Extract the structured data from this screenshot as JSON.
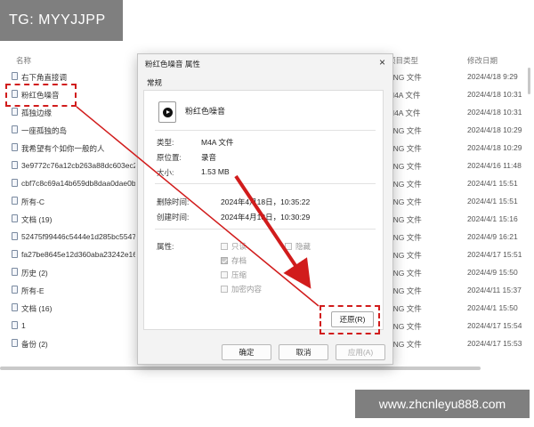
{
  "watermarks": {
    "top": "TG: MYYJJPP",
    "bottom": "www.zhcnleyu888.com"
  },
  "explorer": {
    "columns": {
      "name": "名称",
      "type": "项目类型",
      "date": "修改日期"
    },
    "rows": [
      {
        "name": "右下角直接调",
        "type": "PNG 文件",
        "date": "2024/4/18 9:29"
      },
      {
        "name": "粉红色噪音",
        "type": "M4A 文件",
        "date": "2024/4/18 10:31"
      },
      {
        "name": "孤独边缘",
        "type": "M4A 文件",
        "date": "2024/4/18 10:31"
      },
      {
        "name": "一座孤独的岛",
        "type": "PNG 文件",
        "date": "2024/4/18 10:29"
      },
      {
        "name": "我希望有个如你一般的人",
        "type": "PNG 文件",
        "date": "2024/4/18 10:29"
      },
      {
        "name": "3e9772c76a12cb263a88dc603ec2",
        "type": "PNG 文件",
        "date": "2024/4/16 11:48"
      },
      {
        "name": "cbf7c8c69a14b659db8daa0dae0b",
        "type": "PNG 文件",
        "date": "2024/4/1 15:51"
      },
      {
        "name": "所有-C",
        "type": "PNG 文件",
        "date": "2024/4/1 15:51"
      },
      {
        "name": "文档 (19)",
        "type": "PNG 文件",
        "date": "2024/4/1 15:16"
      },
      {
        "name": "52475f99446c5444e1d285bc5547",
        "type": "PNG 文件",
        "date": "2024/4/9 16:21"
      },
      {
        "name": "fa27be8645e12d360aba23242e16",
        "type": "PNG 文件",
        "date": "2024/4/17 15:51"
      },
      {
        "name": "历史 (2)",
        "type": "PNG 文件",
        "date": "2024/4/9 15:50"
      },
      {
        "name": "所有-E",
        "type": "PNG 文件",
        "date": "2024/4/11 15:37"
      },
      {
        "name": "文档 (16)",
        "type": "PNG 文件",
        "date": "2024/4/1 15:50"
      },
      {
        "name": "1",
        "type": "PNG 文件",
        "date": "2024/4/17 15:54"
      },
      {
        "name": "备份 (2)",
        "type": "PNG 文件",
        "date": "2024/4/17 15:53"
      }
    ]
  },
  "dialog": {
    "title": "粉红色噪音 属性",
    "close": "×",
    "tab": "常规",
    "file_name": "粉红色噪音",
    "props": {
      "type_label": "类型:",
      "type_value": "M4A 文件",
      "location_label": "原位置:",
      "location_value": "录音",
      "size_label": "大小:",
      "size_value": "1.53 MB",
      "deleted_label": "删除时间:",
      "deleted_value": "2024年4月18日，10:35:22",
      "created_label": "创建时间:",
      "created_value": "2024年4月18日，10:30:29",
      "attributes_label": "属性:"
    },
    "attributes": {
      "readonly": "只读",
      "hidden": "隐藏",
      "archive": "存档",
      "compress": "压缩",
      "encrypt": "加密内容"
    },
    "restore": "还原(R)",
    "buttons": {
      "ok": "确定",
      "cancel": "取消",
      "apply": "应用(A)"
    }
  },
  "colors": {
    "highlight": "#d11c1c",
    "tab_underline": "#2e6fd4",
    "watermark_bg": "#7f7f7f"
  }
}
